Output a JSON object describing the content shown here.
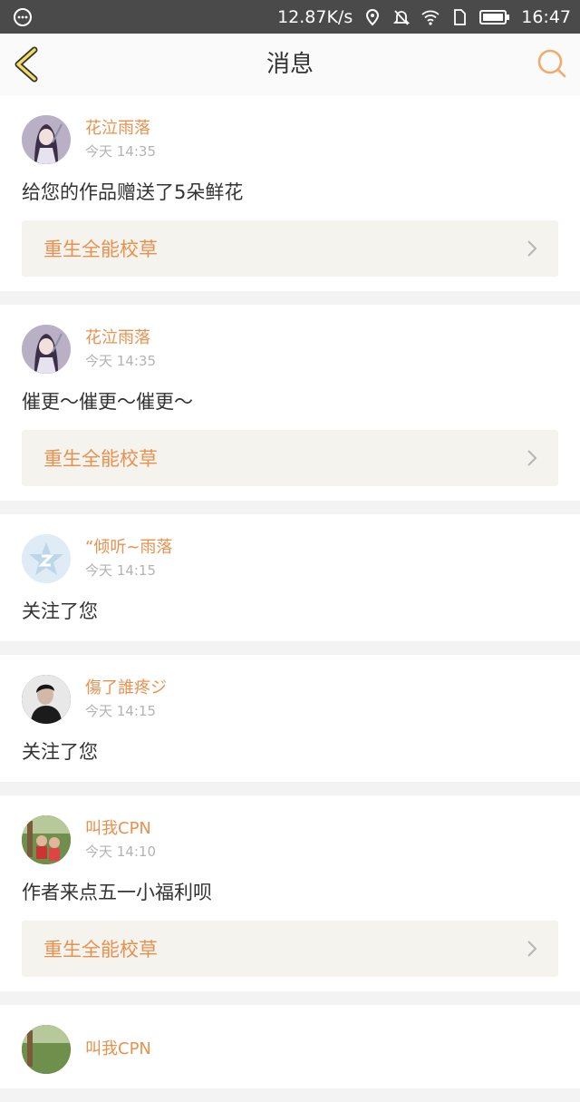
{
  "status_bar": {
    "speed": "12.87K/s",
    "time": "16:47"
  },
  "header": {
    "title": "消息"
  },
  "messages": [
    {
      "name": "花泣雨落",
      "time": "今天 14:35",
      "text": "给您的作品赠送了5朵鲜花",
      "book": "重生全能校草",
      "avatar": "anime-girl"
    },
    {
      "name": "花泣雨落",
      "time": "今天 14:35",
      "text": "催更～催更～催更～",
      "book": "重生全能校草",
      "avatar": "anime-girl"
    },
    {
      "name": "“倾听~雨落",
      "time": "今天 14:15",
      "text": "关注了您",
      "avatar": "default-star"
    },
    {
      "name": "傷了誰疼ジ",
      "time": "今天 14:15",
      "text": "关注了您",
      "avatar": "man-dark"
    },
    {
      "name": "叫我CPN",
      "time": "今天 14:10",
      "text": "作者来点五一小福利呗",
      "book": "重生全能校草",
      "avatar": "kids-outdoor"
    },
    {
      "name": "叫我CPN",
      "avatar": "kids-outdoor"
    }
  ],
  "colors": {
    "accent": "#e8914e",
    "status_bar": "#4a4a4a",
    "book_bg": "#f4f3ee"
  }
}
